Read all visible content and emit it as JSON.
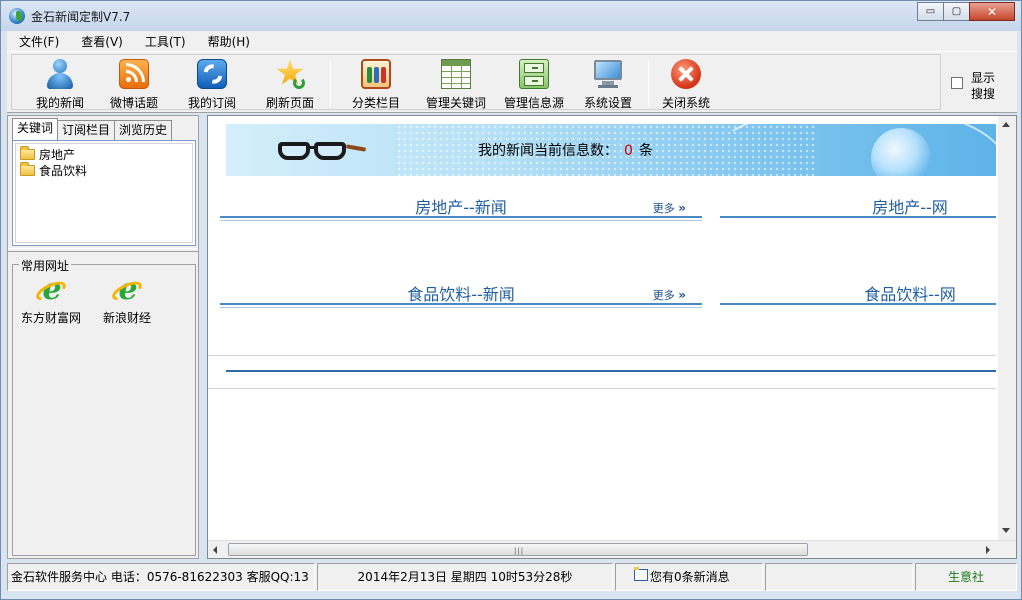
{
  "window": {
    "title": "金石新闻定制V7.7",
    "controls": {
      "minimize": "▭",
      "maximize": "▢",
      "close": "✕"
    }
  },
  "menubar": {
    "items": [
      "文件(F)",
      "查看(V)",
      "工具(T)",
      "帮助(H)"
    ]
  },
  "toolbar": {
    "buttons": [
      {
        "label": "我的新闻",
        "icon": "person-icon"
      },
      {
        "label": "微博话题",
        "icon": "rss-icon"
      },
      {
        "label": "我的订阅",
        "icon": "subscribe-icon"
      },
      {
        "label": "刷新页面",
        "icon": "star-refresh-icon"
      },
      {
        "label": "分类栏目",
        "icon": "category-icon"
      },
      {
        "label": "管理关键词",
        "icon": "table-icon"
      },
      {
        "label": "管理信息源",
        "icon": "cabinet-icon"
      },
      {
        "label": "系统设置",
        "icon": "monitor-icon"
      },
      {
        "label": "关闭系统",
        "icon": "close-circle-icon"
      }
    ],
    "show_search_label": "显示搜搜"
  },
  "left_panel": {
    "tabs": [
      "关键词",
      "订阅栏目",
      "浏览历史"
    ],
    "active_tab": "关键词",
    "keywords": [
      "房地产",
      "食品饮料"
    ],
    "common_sites_title": "常用网址",
    "common_sites": [
      "东方财富网",
      "新浪财经"
    ]
  },
  "main": {
    "banner_text": "我的新闻当前信息数：",
    "banner_count": "0",
    "banner_unit": "条",
    "sections": [
      {
        "title": "房地产--新闻",
        "more": "更多"
      },
      {
        "title": "房地产--网",
        "more": ""
      },
      {
        "title": "食品饮料--新闻",
        "more": "更多"
      },
      {
        "title": "食品饮料--网",
        "more": ""
      }
    ]
  },
  "statusbar": {
    "service": "金石软件服务中心 电话：0576-81622303  客服QQ:13",
    "datetime": "2014年2月13日   星期四    10时53分28秒",
    "messages": "您有0条新消息",
    "blank": "",
    "brand": "生意社"
  },
  "colors": {
    "accent_blue": "#1f5fa0",
    "count_red": "#d40000",
    "brand_green": "#1a7a1a"
  }
}
